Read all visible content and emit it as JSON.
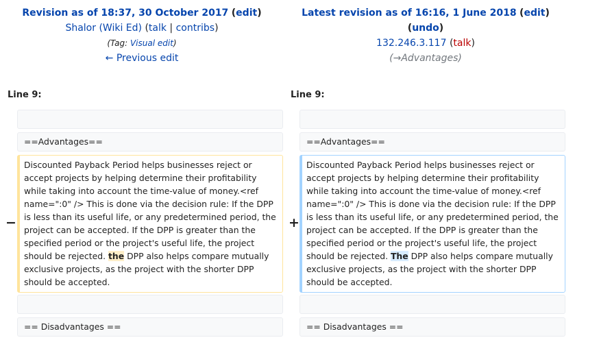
{
  "left": {
    "title": "Revision as of 18:37, 30 October 2017",
    "edit": "edit",
    "user": "Shalor (Wiki Ed)",
    "talk": "talk",
    "contribs": "contribs",
    "tag_prefix": "(Tag: ",
    "tag_link": "Visual edit",
    "prev_edit": "← Previous edit",
    "line_label": "Line 9:",
    "marker": "−",
    "context1": "",
    "context2": "==Advantages==",
    "changed_before": "Discounted Payback Period helps businesses reject or accept projects by helping determine their profitability while taking into account the time-value of money.<ref name=\":0\" /> This is done via the decision rule: If the DPP is less than its useful life, or any predetermined period, the project can be accepted. If the DPP is greater than the specified period or the project's useful life, the project should be rejected. ",
    "changed_word": "the",
    "changed_after": " DPP also helps compare mutually exclusive projects, as the project with the shorter DPP should be accepted.",
    "context3": "",
    "context4": "== Disadvantages =="
  },
  "right": {
    "title": "Latest revision as of 16:16, 1 June 2018",
    "edit": "edit",
    "undo": "undo",
    "ip": "132.246.3.117",
    "talk": "talk",
    "section_arrow": "→",
    "section_name": "Advantages",
    "line_label": "Line 9:",
    "marker": "+",
    "context1": "",
    "context2": "==Advantages==",
    "changed_before": "Discounted Payback Period helps businesses reject or accept projects by helping determine their profitability while taking into account the time-value of money.<ref name=\":0\" /> This is done via the decision rule: If the DPP is less than its useful life, or any predetermined period, the project can be accepted. If the DPP is greater than the specified period or the project's useful life, the project should be rejected. ",
    "changed_word": "The",
    "changed_after": " DPP also helps compare mutually exclusive projects, as the project with the shorter DPP should be accepted.",
    "context3": "",
    "context4": "== Disadvantages =="
  }
}
